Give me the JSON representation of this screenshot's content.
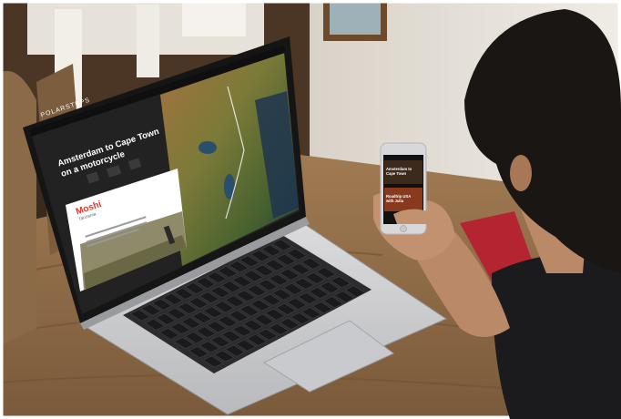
{
  "laptop_screen": {
    "brand": "POLARSTEPS",
    "trip_title_line1": "Amsterdam to Cape Town",
    "trip_title_line2": "on a motorcycle",
    "card_title": "Moshi",
    "card_subtitle": "Tanzania",
    "colors": {
      "card_title": "#e23b2e",
      "header_bg": "#1b1b1b",
      "card_bg": "#ffffff"
    }
  },
  "phone_screen": {
    "cards": [
      {
        "line1": "Amsterdam to",
        "line2": "Cape Town"
      },
      {
        "line1": "Roadtrip USA",
        "line2": "with Julia"
      }
    ]
  }
}
